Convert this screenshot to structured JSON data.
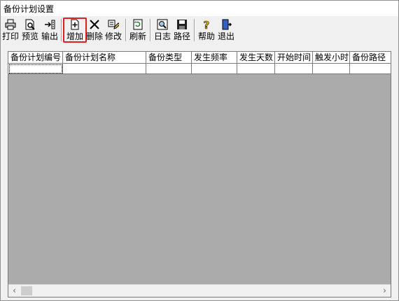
{
  "window": {
    "title": "备份计划设置"
  },
  "toolbar": {
    "buttons": [
      {
        "label": "打印",
        "icon": "printer-icon"
      },
      {
        "label": "预览",
        "icon": "preview-icon"
      },
      {
        "label": "输出",
        "icon": "export-icon"
      },
      {
        "label": "增加",
        "icon": "add-icon",
        "highlighted": true
      },
      {
        "label": "删除",
        "icon": "delete-icon"
      },
      {
        "label": "修改",
        "icon": "edit-icon"
      },
      {
        "label": "刷新",
        "icon": "refresh-icon"
      },
      {
        "label": "日志",
        "icon": "log-icon"
      },
      {
        "label": "路径",
        "icon": "save-path-icon"
      },
      {
        "label": "帮助",
        "icon": "help-icon"
      },
      {
        "label": "退出",
        "icon": "exit-icon"
      }
    ]
  },
  "table": {
    "columns": [
      "备份计划编号",
      "备份计划名称",
      "备份类型",
      "发生频率",
      "发生天数",
      "开始时间",
      "触发小时",
      "备份路径"
    ]
  },
  "scrollbar": {
    "left_arrow": "‹",
    "right_arrow": "›"
  },
  "colors": {
    "highlight": "#e02020",
    "grid_bg": "#ababab"
  }
}
